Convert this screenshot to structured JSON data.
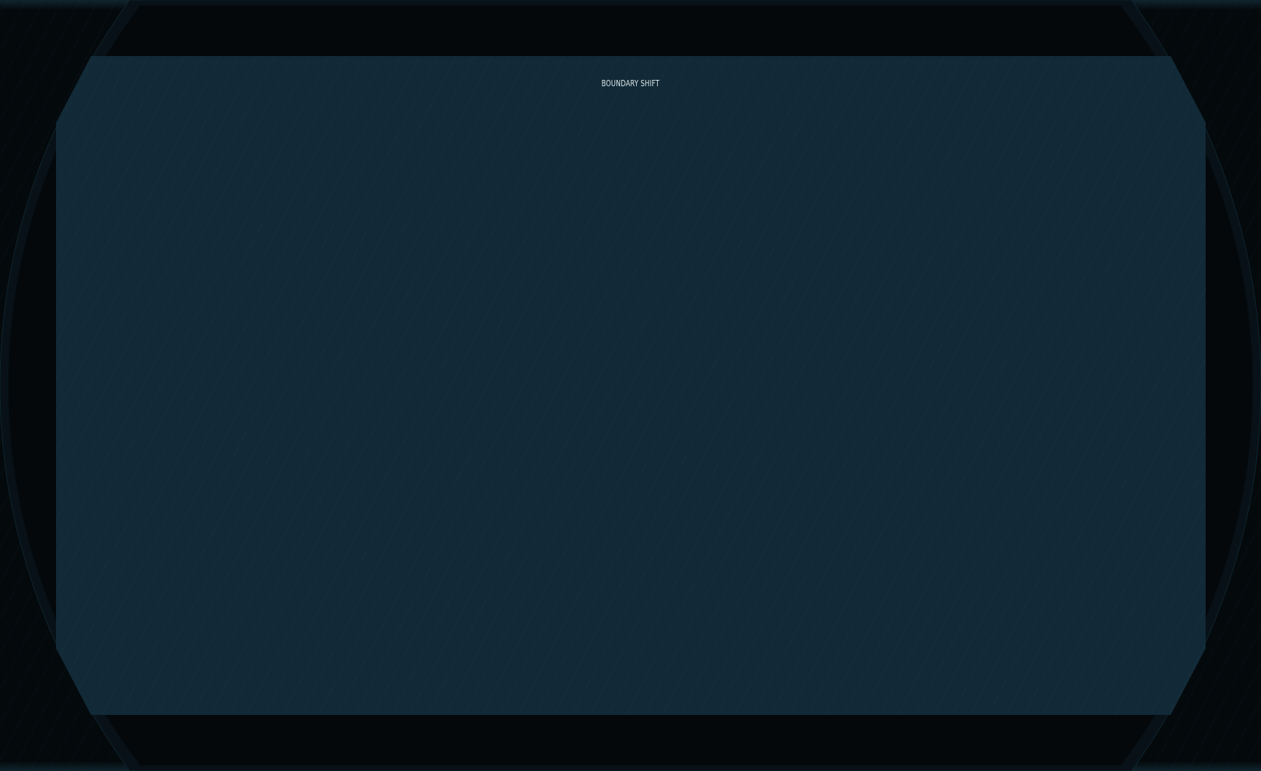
{
  "game": {
    "title": "BOUNDARY SHIFT"
  },
  "colors": {
    "background": "#04090c",
    "screen_panel": "#122a37",
    "outer_frame": "#0a1419",
    "title_text": "#dbe6ea"
  }
}
